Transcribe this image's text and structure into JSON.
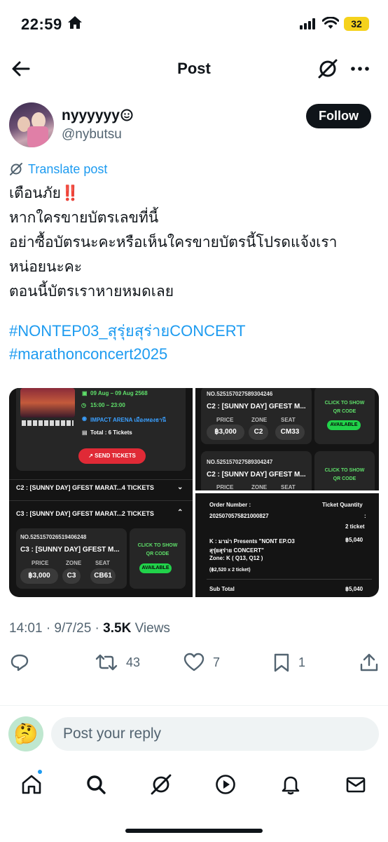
{
  "status": {
    "time": "22:59",
    "battery": "32"
  },
  "nav": {
    "title": "Post"
  },
  "author": {
    "name": "nyyyyyy",
    "handle": "@nybutsu",
    "follow_label": "Follow"
  },
  "post": {
    "translate_label": "Translate post",
    "lines": [
      "เตือนภัย",
      "หากใครขายบัตรเลขที่นี้",
      "อย่าซื้อบัตรนะคะหรือเห็นใครขายบัตรนี้โปรดแจ้งเรา",
      "หน่อยนะคะ",
      "ตอนนี้บัตรเราหายหมดเลย"
    ],
    "alert_emoji": "‼️",
    "hashtags": [
      "#NONTEP03_สุรุ่ยสุร่ายCONCERT",
      "#marathonconcert2025"
    ]
  },
  "media": {
    "img1": {
      "date": "09 Aug – 09 Aug 2568",
      "time": "15:00 – 23:00",
      "venue": "IMPACT ARENA เมืองทองธานี",
      "total": "Total : 6 Tickets",
      "send_label": "SEND TICKETS",
      "group_c2": "C2 : [SUNNY DAY] GFEST MARAT...4 TICKETS",
      "group_c3": "C3 : [SUNNY DAY] GFEST MARAT...2 TICKETS",
      "ticket_no": "NO.525157026519406248",
      "ticket_name": "C3 : [SUNNY DAY] GFEST M...",
      "price_label": "PRICE",
      "zone_label": "ZONE",
      "seat_label": "SEAT",
      "price": "฿3,000",
      "zone": "C3",
      "seat": "CB61",
      "click_label": "CLICK TO SHOW QR CODE",
      "available": "AVAILABLE"
    },
    "img2": {
      "ticket1_no": "NO.525157027589304246",
      "ticket1_name": "C2 : [SUNNY DAY] GFEST M...",
      "price": "฿3,000",
      "zone": "C2",
      "seat": "CM33",
      "ticket2_no": "NO.525157027589304247",
      "ticket2_name": "C2 : [SUNNY DAY] GFEST M...",
      "price_label": "PRICE",
      "zone_label": "ZONE",
      "seat_label": "SEAT",
      "click_label": "CLICK TO SHOW QR CODE",
      "available": "AVAILABLE"
    },
    "img3": {
      "order_label": "Order Number :",
      "qty_label": "Ticket Quantity",
      "order_no": "2025070575821000827",
      "colon": ":",
      "qty": "2 ticket",
      "item_line1": "K : มาม่า Presents \"NONT EP.O3",
      "item_line2": "สุรุ่ยสุร่าย CONCERT\"",
      "item_line3": "Zone: K ( Q13, Q12 )",
      "item_calc": "(฿2,520 x 2 ticket)",
      "item_price": "฿5,040",
      "subtotal_label": "Sub Total",
      "subtotal": "฿5,040"
    }
  },
  "meta": {
    "time": "14:01 · 9/7/25 · ",
    "views_count": "3.5K",
    "views_label": " Views"
  },
  "actions": {
    "retweets": "43",
    "likes": "7",
    "bookmarks": "1"
  },
  "reply": {
    "placeholder": "Post your reply",
    "avatar_emoji": "🤔"
  }
}
